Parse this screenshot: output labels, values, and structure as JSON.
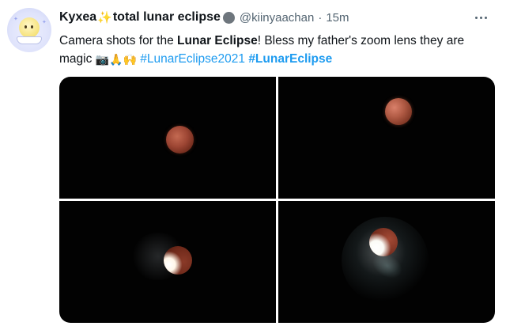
{
  "tweet": {
    "display_name": "Kyxea",
    "sparkle_emoji": "✨",
    "display_name_suffix": "total lunar eclipse",
    "handle": "@kiinyaachan",
    "separator": "·",
    "time": "15m",
    "text": {
      "part1": "Camera shots for the ",
      "bold1": "Lunar Eclipse",
      "part2": "! Bless my father's zoom lens they are magic ",
      "emoji_camera": "📷",
      "emoji_pray": "🙏",
      "emoji_hands": "🙌",
      "hashtag1": "#LunarEclipse2021",
      "hashtag2": "#LunarEclipse"
    }
  },
  "colors": {
    "link": "#1d9bf0",
    "secondary_text": "#536471",
    "primary_text": "#0f1419",
    "photo_bg": "#020202"
  },
  "icons": {
    "more": "more-horizontal-icon",
    "badge": "gray-circle-badge-icon"
  }
}
